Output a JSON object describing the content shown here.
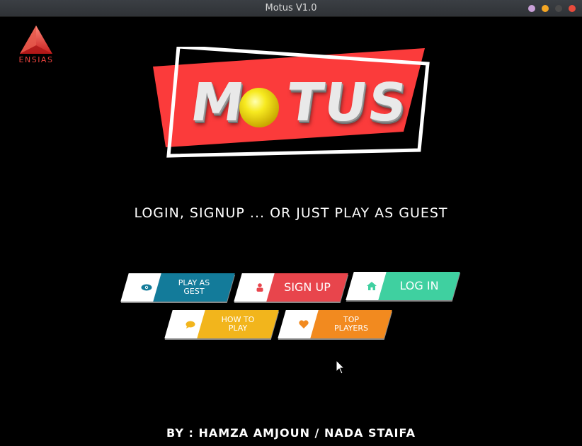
{
  "window": {
    "title": "Motus V1.0",
    "controls": {
      "minimize_color": "#c9a0d8",
      "maximize_color": "#f5a623",
      "extra_color": "#4a4a4a",
      "close_color": "#e94b3c"
    }
  },
  "branding": {
    "school_logo_text": "ENSIAS",
    "app_logo_text": "MOTUS",
    "logo_red": "#fb3b3b",
    "ball_color": "#f3e01a"
  },
  "tagline": "LOGIN, SIGNUP ... OR JUST PLAY AS GUEST",
  "buttons": {
    "play_guest": {
      "label_line1": "PLAY AS",
      "label_line2": "GEST",
      "icon": "eye-icon",
      "color": "#137b9a",
      "icon_color": "#137b9a"
    },
    "sign_up": {
      "label": "SIGN UP",
      "icon": "user-icon",
      "color": "#e8454c",
      "icon_color": "#e8454c"
    },
    "log_in": {
      "label": "LOG IN",
      "icon": "home-icon",
      "color": "#3fd0a0",
      "icon_color": "#3fd0a0"
    },
    "how_to_play": {
      "label_line1": "HOW TO",
      "label_line2": "PLAY",
      "icon": "chat-icon",
      "color": "#f2b51c",
      "icon_color": "#f2b51c"
    },
    "top_players": {
      "label_line1": "TOP",
      "label_line2": "PLAYERS",
      "icon": "heart-icon",
      "color": "#f28a1f",
      "icon_color": "#f28a1f"
    }
  },
  "credit": "BY : HAMZA AMJOUN / NADA STAIFA"
}
